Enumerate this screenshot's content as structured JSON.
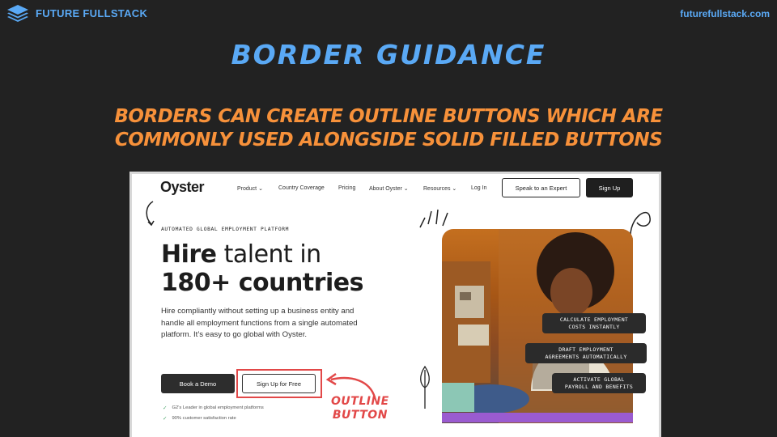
{
  "brand": {
    "name": "FUTURE FULLSTACK",
    "url": "futurefullstack.com",
    "accent": "#5aa9f5"
  },
  "slide": {
    "title": "BORDER GUIDANCE",
    "subtitle_line1": "BORDERS CAN CREATE OUTLINE BUTTONS WHICH ARE",
    "subtitle_line2": "COMMONLY USED ALONGSIDE SOLID FILLED BUTTONS",
    "subtitle_color": "#f7913a"
  },
  "screenshot": {
    "logo": "Oyster",
    "nav": {
      "product": "Product",
      "country_coverage": "Country Coverage",
      "pricing": "Pricing",
      "about": "About Oyster",
      "resources": "Resources",
      "login": "Log In",
      "speak_expert": "Speak to an Expert",
      "sign_up": "Sign Up"
    },
    "eyebrow": "AUTOMATED GLOBAL EMPLOYMENT PLATFORM",
    "hero": {
      "line1_bold": "Hire",
      "line1_rest": "talent in",
      "line2": "180+ countries"
    },
    "description": "Hire compliantly without setting up a business entity and handle all employment functions from a single automated platform. It’s easy to go global with Oyster.",
    "buttons": {
      "book_demo": "Book a Demo",
      "sign_up_free": "Sign Up for Free"
    },
    "checks": [
      "G2’s Leader in global employment platforms",
      "90% customer satisfaction rate"
    ],
    "pills": [
      {
        "line1": "CALCULATE EMPLOYMENT",
        "line2": "COSTS INSTANTLY"
      },
      {
        "line1": "DRAFT EMPLOYMENT",
        "line2": "AGREEMENTS AUTOMATICALLY"
      },
      {
        "line1": "ACTIVATE GLOBAL",
        "line2": "PAYROLL AND BENEFITS"
      }
    ]
  },
  "annotation": {
    "line1": "OUTLINE",
    "line2": "BUTTON",
    "color": "#e24848"
  }
}
